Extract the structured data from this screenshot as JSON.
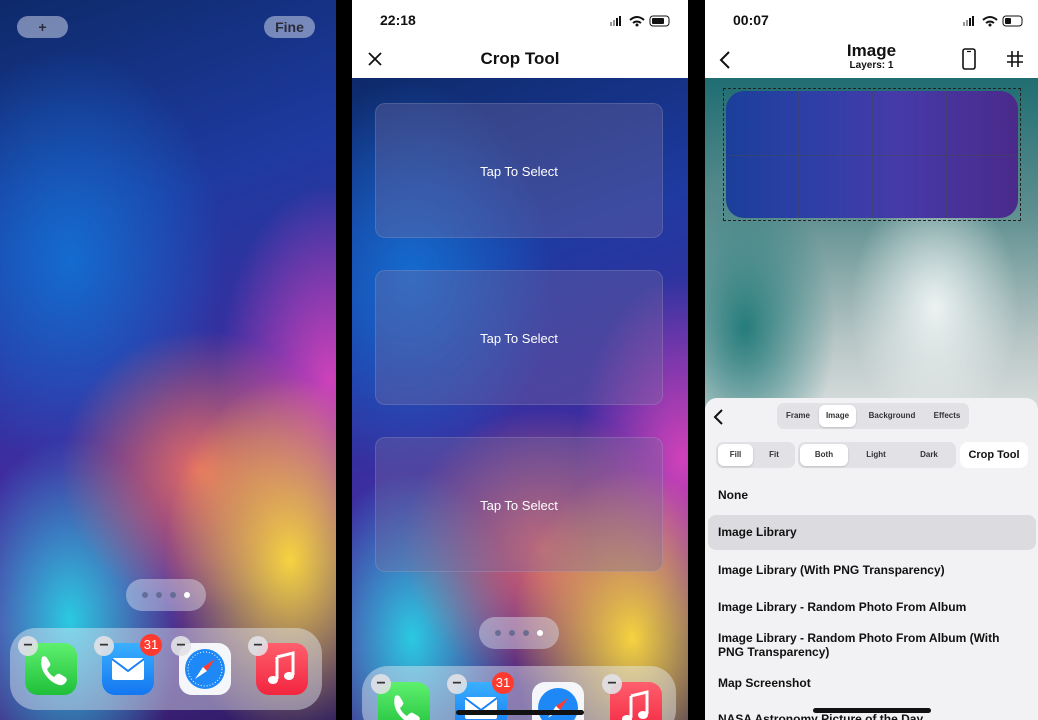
{
  "home": {
    "add_label": "+",
    "done_label": "Fine",
    "dock_apps": [
      {
        "name": "Phone",
        "icon": "phone-icon"
      },
      {
        "name": "Mail",
        "icon": "mail-icon",
        "badge": "31"
      },
      {
        "name": "Safari",
        "icon": "compass-icon"
      },
      {
        "name": "Music",
        "icon": "music-note-icon"
      }
    ],
    "page_count": 4,
    "current_page": 4
  },
  "crop": {
    "status_time": "22:18",
    "title": "Crop Tool",
    "cards": [
      "Tap To Select",
      "Tap To Select",
      "Tap To Select"
    ],
    "dock_badge": "31"
  },
  "editor": {
    "status_time": "00:07",
    "title": "Image",
    "subtitle": "Layers: 1",
    "tabs": [
      "Frame",
      "Image",
      "Background",
      "Effects"
    ],
    "selected_tab": "Image",
    "fill_options": [
      "Fill",
      "Fit"
    ],
    "mode_options": [
      "Both",
      "Light",
      "Dark"
    ],
    "crop_tool_label": "Crop Tool",
    "sources": [
      "None",
      "Image Library",
      "Image Library (With PNG Transparency)",
      "Image Library - Random Photo From Album",
      "Image Library - Random Photo From Album (With PNG Transparency)",
      "Map Screenshot",
      "NASA Astronomy Picture of the Day"
    ],
    "selected_source": "Image Library"
  },
  "colors": {
    "badge": "#ff3b30",
    "sheet": "#f2f2f4"
  }
}
